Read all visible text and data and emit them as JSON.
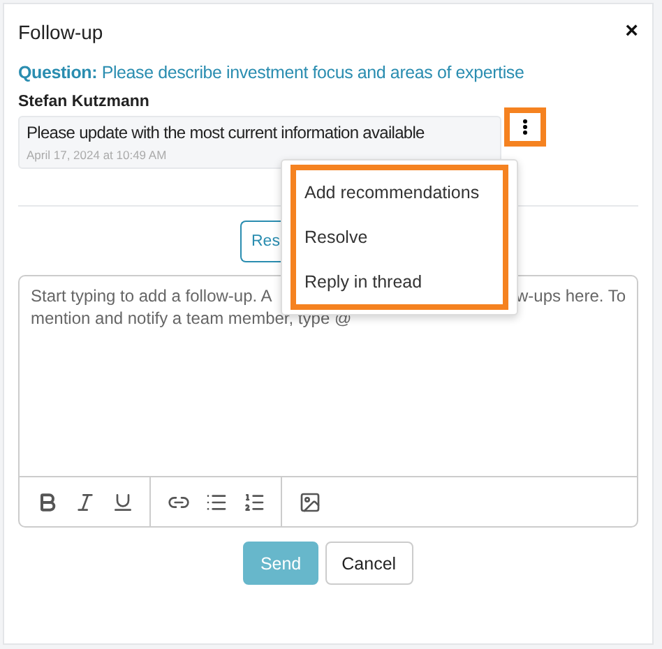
{
  "dialog": {
    "title": "Follow-up",
    "close": "×"
  },
  "question": {
    "label": "Question:",
    "text": "Please describe investment focus and areas of expertise"
  },
  "comment": {
    "author": "Stefan Kutzmann",
    "text": "Please update with the most current information available",
    "time": "April 17, 2024 at 10:49 AM",
    "menu_highlighted": true
  },
  "menu": {
    "highlighted": true,
    "items": [
      {
        "label": "Add recommendations"
      },
      {
        "label": "Resolve"
      },
      {
        "label": "Reply in thread"
      }
    ]
  },
  "partial_button": "Res",
  "editor": {
    "placeholder_parts": [
      "Start typing to add a follow-up. A",
      "w-ups here. To",
      "mention and notify a team member, type @"
    ]
  },
  "toolbar": [
    {
      "kind": "bold"
    },
    {
      "kind": "italic"
    },
    {
      "kind": "underline"
    },
    {
      "kind": "separator"
    },
    {
      "kind": "link"
    },
    {
      "kind": "bullets"
    },
    {
      "kind": "numbers"
    },
    {
      "kind": "separator"
    },
    {
      "kind": "image"
    }
  ],
  "buttons": [
    {
      "label": "Send",
      "primary": true
    },
    {
      "label": "Cancel",
      "primary": false
    }
  ]
}
